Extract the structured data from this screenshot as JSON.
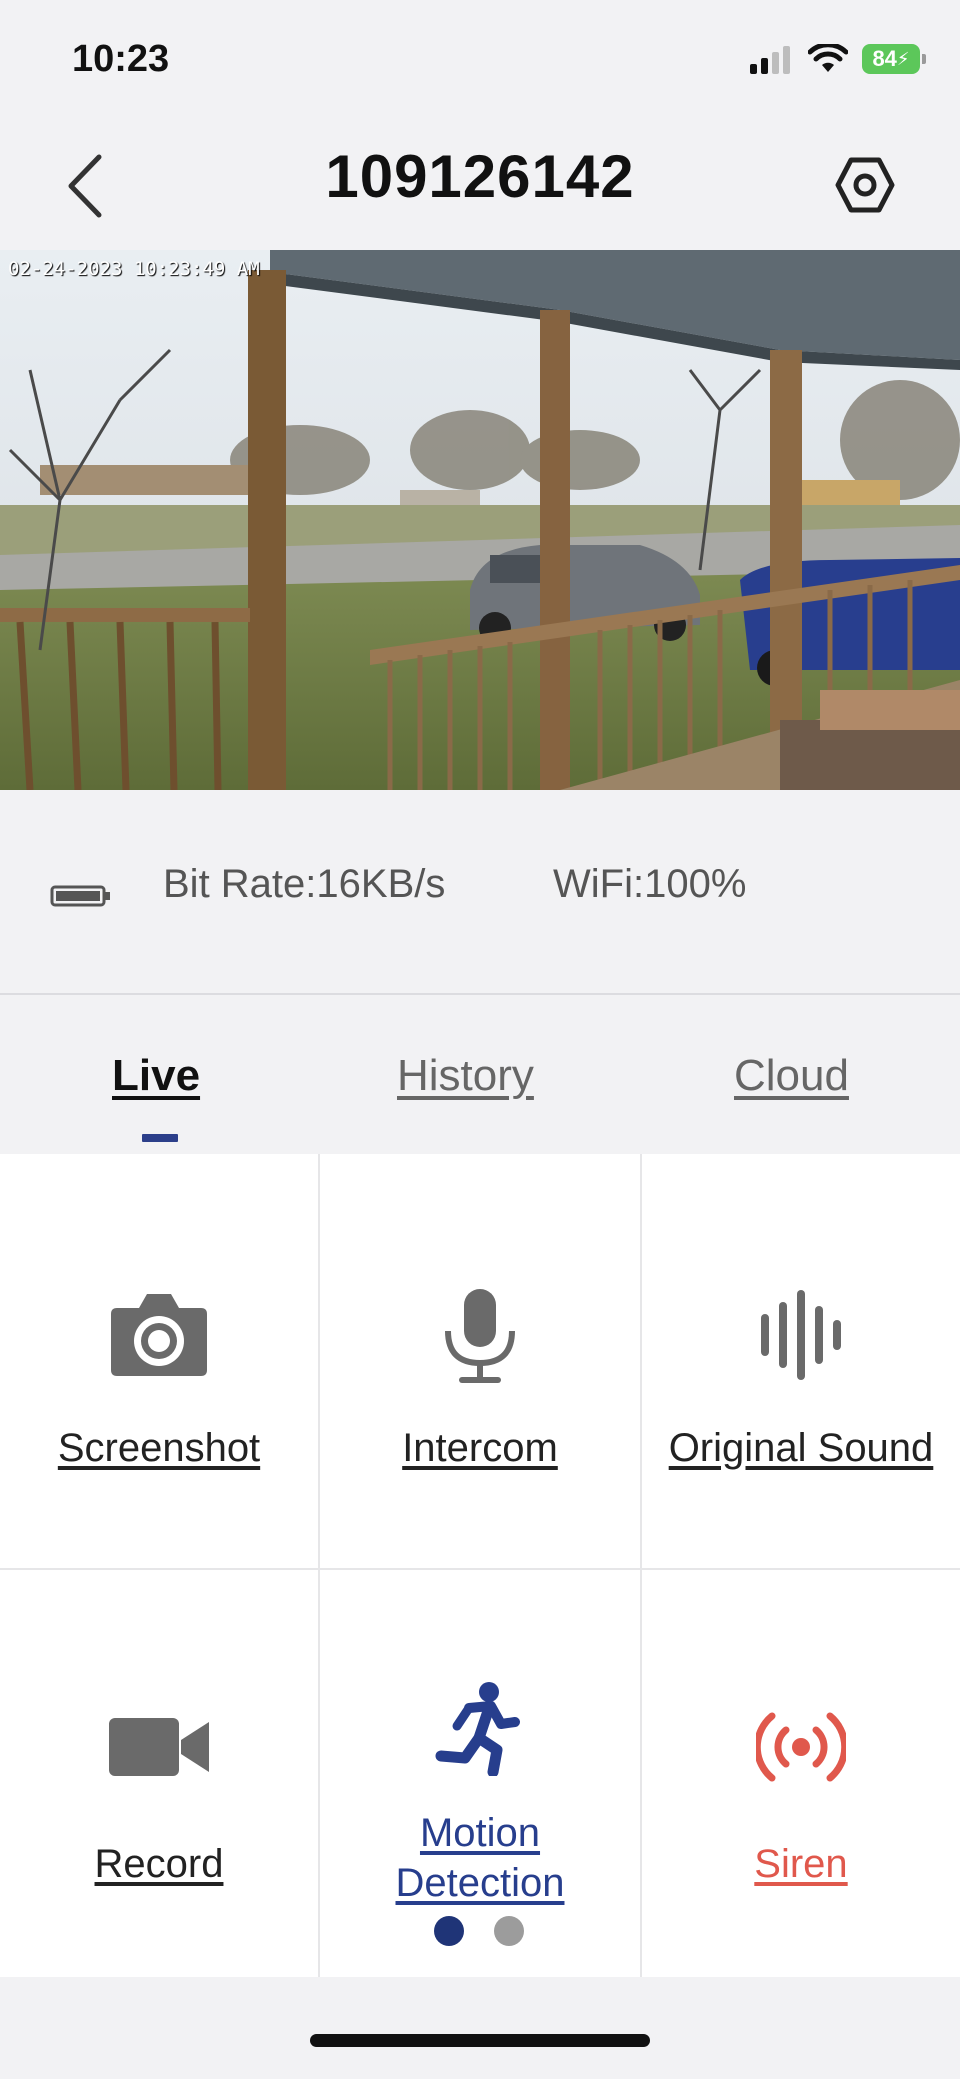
{
  "status_bar": {
    "time": "10:23",
    "battery": "84"
  },
  "nav": {
    "title": "109126142"
  },
  "video": {
    "timestamp": "02-24-2023 10:23:49 AM"
  },
  "info": {
    "bit_rate": "Bit Rate:16KB/s",
    "wifi": "WiFi:100%"
  },
  "tabs": [
    {
      "label": "Live",
      "active": true
    },
    {
      "label": "History",
      "active": false
    },
    {
      "label": "Cloud",
      "active": false
    }
  ],
  "controls": [
    {
      "label": "Screenshot",
      "icon": "camera-icon"
    },
    {
      "label": "Intercom",
      "icon": "microphone-icon"
    },
    {
      "label": "Original Sound",
      "icon": "sound-wave-icon"
    },
    {
      "label": "Record",
      "icon": "video-camera-icon"
    },
    {
      "label": "Motion\nDetection",
      "icon": "running-person-icon"
    },
    {
      "label": "Siren",
      "icon": "siren-icon"
    }
  ],
  "pagination": {
    "pages": 2,
    "current": 1
  },
  "colors": {
    "accent_blue": "#273e8d",
    "siren_red": "#e0584c",
    "battery_green": "#5cc75a"
  }
}
